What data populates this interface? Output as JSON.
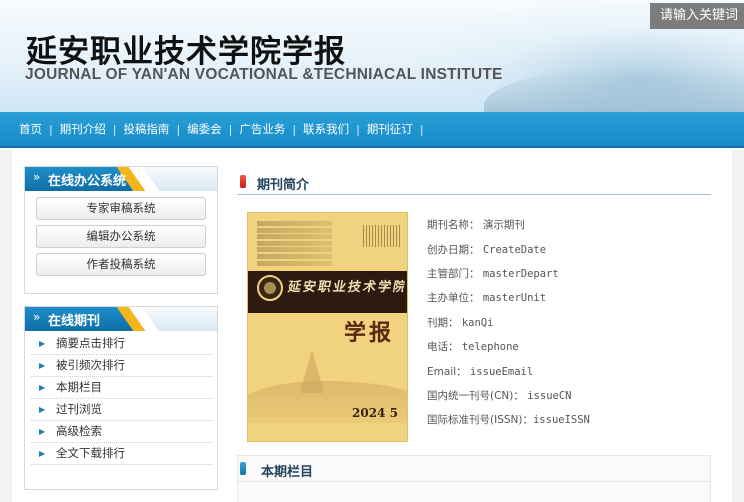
{
  "header": {
    "title": "延安职业技术学院学报",
    "subtitle": "JOURNAL OF YAN'AN VOCATIONAL &TECHNIACAL INSTITUTE",
    "search_placeholder": "请输入关键词"
  },
  "nav": {
    "items": [
      "首页",
      "期刊介绍",
      "投稿指南",
      "编委会",
      "广告业务",
      "联系我们",
      "期刊征订"
    ],
    "separator": "|"
  },
  "sidebar": {
    "office": {
      "title": "在线办公系统",
      "chevron": "»",
      "buttons": [
        "专家审稿系统",
        "编辑办公系统",
        "作者投稿系统"
      ]
    },
    "journal": {
      "title": "在线期刊",
      "chevron": "»",
      "items": [
        "摘要点击排行",
        "被引频次排行",
        "本期栏目",
        "过刊浏览",
        "高级检索",
        "全文下载排行"
      ],
      "arrow": "▶"
    }
  },
  "intro": {
    "title": "期刊简介",
    "cover": {
      "calligraphy": "延安职业技术学院",
      "big_label": "学报",
      "year_label": "2024 5"
    },
    "fields": [
      {
        "label": "期刊名称：",
        "value": "演示期刊"
      },
      {
        "label": "创办日期：",
        "value": "CreateDate"
      },
      {
        "label": "主管部门：",
        "value": "masterDepart"
      },
      {
        "label": "主办单位：",
        "value": "masterUnit"
      },
      {
        "label": "刊期：",
        "value": "kanQi"
      },
      {
        "label": "电话：",
        "value": "telephone"
      },
      {
        "label": "Email：",
        "value": "issueEmail"
      },
      {
        "label": "国内统一刊号(CN)：",
        "value": "issueCN"
      },
      {
        "label": "国际标准刊号(ISSN)：",
        "value": "issueISSN"
      }
    ]
  },
  "current_issue": {
    "title": "本期栏目"
  },
  "colors": {
    "nav_blue": "#1a92ce",
    "panel_blue": "#1d8fca",
    "accent_yellow": "#f2b51c",
    "cover_yellow": "#f0d27f"
  }
}
